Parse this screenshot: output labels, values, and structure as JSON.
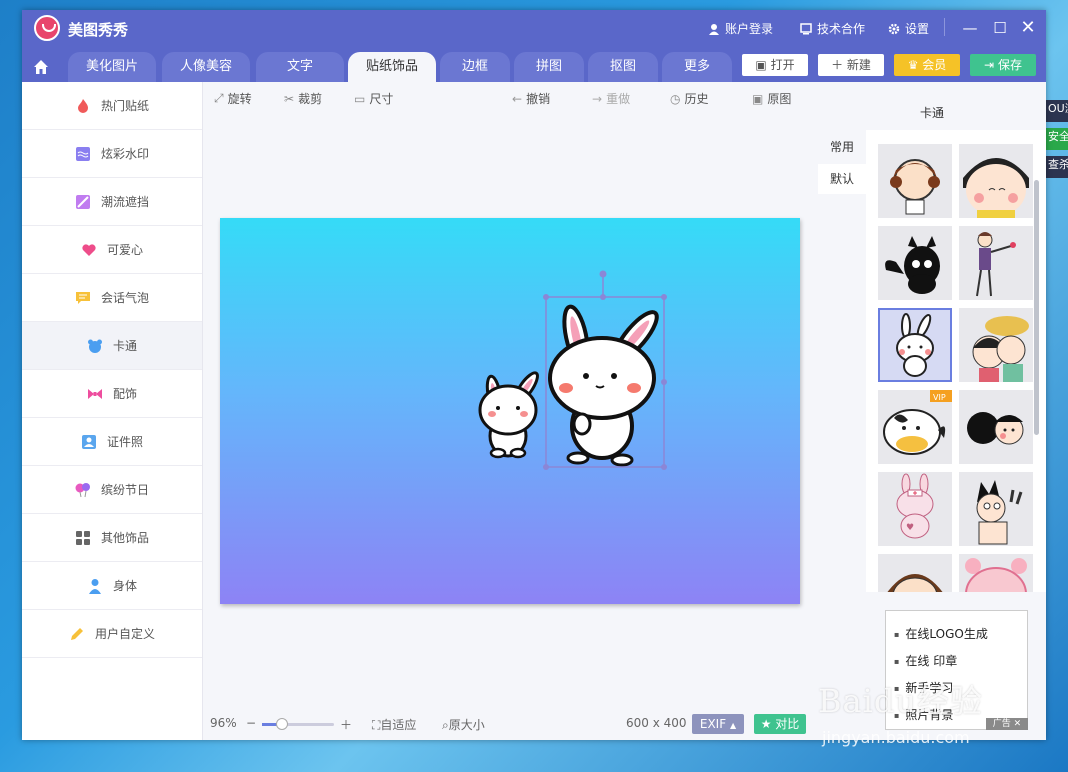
{
  "desktop": {
    "right_items": [
      "OU浏",
      "安全",
      "查杀"
    ]
  },
  "app": {
    "title": "美图秀秀"
  },
  "titlebar": {
    "login": "账户登录",
    "tech": "技术合作",
    "settings": "设置"
  },
  "tabs": [
    "美化图片",
    "人像美容",
    "文字",
    "贴纸饰品",
    "边框",
    "拼图",
    "抠图",
    "更多"
  ],
  "active_tab": "贴纸饰品",
  "header_buttons": {
    "open": "打开",
    "new": "新建",
    "vip": "会员",
    "save": "保存"
  },
  "categories": [
    "热门贴纸",
    "炫彩水印",
    "潮流遮挡",
    "可爱心",
    "会话气泡",
    "卡通",
    "配饰",
    "证件照",
    "缤纷节日",
    "其他饰品",
    "身体",
    "用户自定义"
  ],
  "active_category": "卡通",
  "toolbar": {
    "rotate": "旋转",
    "crop": "裁剪",
    "size": "尺寸",
    "undo": "撤销",
    "redo": "重做",
    "history": "历史",
    "original": "原图"
  },
  "right_panel": {
    "title": "卡通",
    "tab_common": "常用",
    "tab_default": "默认",
    "vip_badge": "VIP"
  },
  "ad": {
    "items": [
      "在线LOGO生成",
      "在线 印章",
      "新手学习",
      "照片背景"
    ],
    "label": "广告"
  },
  "status": {
    "zoom": "96%",
    "fit": "自适应",
    "original_size": "原大小",
    "dimensions": "600 x 400",
    "exif": "EXIF",
    "compare": "对比"
  },
  "watermark": {
    "main": "Baidu经验",
    "sub": "jingyan.baidu.com"
  },
  "colors": {
    "brand": "#5a67c9",
    "vip": "#f5c227",
    "save": "#3fc38f",
    "exif": "#8d93bd",
    "compare": "#3fc38f"
  }
}
